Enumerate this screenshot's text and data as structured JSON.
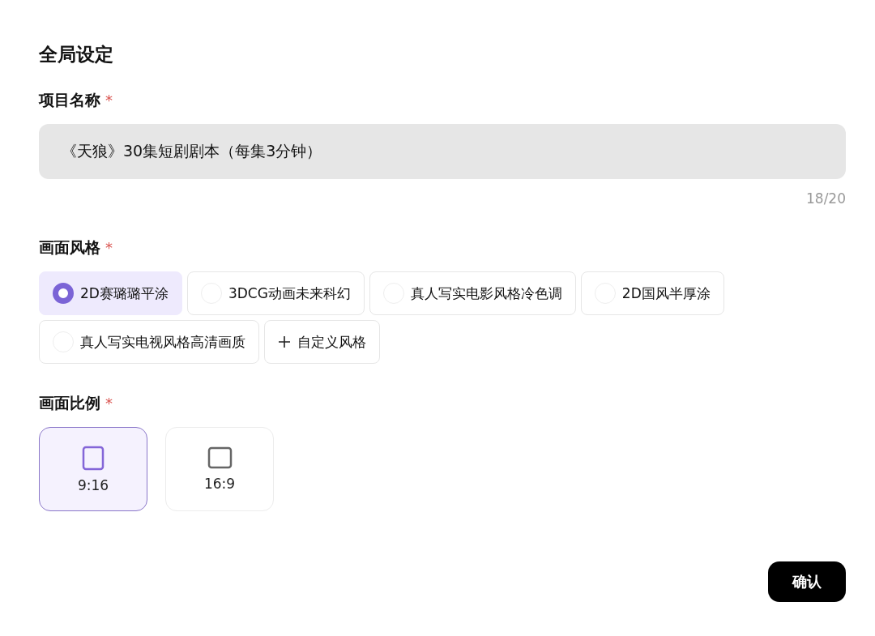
{
  "title": "全局设定",
  "project_name": {
    "label": "项目名称",
    "required_mark": "*",
    "value": "《天狼》30集短剧剧本（每集3分钟）",
    "counter": "18/20"
  },
  "visual_style": {
    "label": "画面风格",
    "required_mark": "*",
    "options": [
      {
        "kind": "radio",
        "label": "2D赛璐璐平涂",
        "selected": true
      },
      {
        "kind": "radio",
        "label": "3DCG动画未来科幻",
        "selected": false
      },
      {
        "kind": "radio",
        "label": "真人写实电影风格冷色调",
        "selected": false
      },
      {
        "kind": "radio",
        "label": "2D国风半厚涂",
        "selected": false
      },
      {
        "kind": "radio",
        "label": "真人写实电视风格高清画质",
        "selected": false
      },
      {
        "kind": "add",
        "label": "自定义风格"
      }
    ]
  },
  "aspect_ratio": {
    "label": "画面比例",
    "required_mark": "*",
    "options": [
      {
        "label": "9:16",
        "kind": "portrait",
        "selected": true
      },
      {
        "label": "16:9",
        "kind": "landscape",
        "selected": false
      }
    ]
  },
  "confirm_button": "确认"
}
